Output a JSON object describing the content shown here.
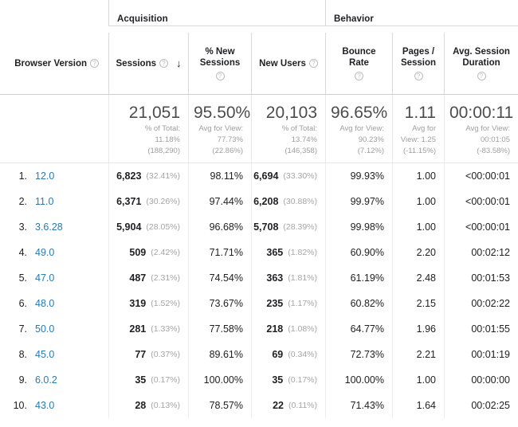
{
  "groups": {
    "acquisition": "Acquisition",
    "behavior": "Behavior"
  },
  "dimension": {
    "label": "Browser Version",
    "help_icon": "help-icon"
  },
  "columns": [
    {
      "key": "sessions",
      "label": "Sessions",
      "help_icon": "help-icon",
      "sorted": true,
      "sort_icon": "arrow-down-icon"
    },
    {
      "key": "pct_new",
      "label": "% New\nSessions",
      "help_icon": "help-icon",
      "sorted": false
    },
    {
      "key": "new_users",
      "label": "New Users",
      "help_icon": "help-icon",
      "sorted": false
    },
    {
      "key": "bounce",
      "label": "Bounce Rate",
      "help_icon": "help-icon",
      "sorted": false
    },
    {
      "key": "pages",
      "label": "Pages /\nSession",
      "help_icon": "help-icon",
      "sorted": false
    },
    {
      "key": "duration",
      "label": "Avg. Session\nDuration",
      "help_icon": "help-icon",
      "sorted": false
    }
  ],
  "summary": {
    "sessions": {
      "big": "21,051",
      "l1": "% of Total:",
      "l2": "11.18%",
      "l3": "(188,290)"
    },
    "pct_new": {
      "big": "95.50%",
      "l1": "Avg for View:",
      "l2": "77.73%",
      "l3": "(22.86%)"
    },
    "new_users": {
      "big": "20,103",
      "l1": "% of Total:",
      "l2": "13.74%",
      "l3": "(146,358)"
    },
    "bounce": {
      "big": "96.65%",
      "l1": "Avg for View:",
      "l2": "90.23%",
      "l3": "(7.12%)"
    },
    "pages": {
      "big": "1.11",
      "l1": "Avg for",
      "l2": "View: 1.25",
      "l3": "(-11.15%)"
    },
    "duration": {
      "big": "00:00:11",
      "l1": "Avg for View:",
      "l2": "00:01:05",
      "l3": "(-83.58%)"
    }
  },
  "rows": [
    {
      "index": "1.",
      "version": "12.0",
      "sessions": "6,823",
      "sessions_pct": "(32.41%)",
      "pct_new": "98.11%",
      "new_users": "6,694",
      "new_users_pct": "(33.30%)",
      "bounce": "99.93%",
      "pages": "1.00",
      "duration": "<00:00:01"
    },
    {
      "index": "2.",
      "version": "11.0",
      "sessions": "6,371",
      "sessions_pct": "(30.26%)",
      "pct_new": "97.44%",
      "new_users": "6,208",
      "new_users_pct": "(30.88%)",
      "bounce": "99.97%",
      "pages": "1.00",
      "duration": "<00:00:01"
    },
    {
      "index": "3.",
      "version": "3.6.28",
      "sessions": "5,904",
      "sessions_pct": "(28.05%)",
      "pct_new": "96.68%",
      "new_users": "5,708",
      "new_users_pct": "(28.39%)",
      "bounce": "99.98%",
      "pages": "1.00",
      "duration": "<00:00:01"
    },
    {
      "index": "4.",
      "version": "49.0",
      "sessions": "509",
      "sessions_pct": "(2.42%)",
      "pct_new": "71.71%",
      "new_users": "365",
      "new_users_pct": "(1.82%)",
      "bounce": "60.90%",
      "pages": "2.20",
      "duration": "00:02:12"
    },
    {
      "index": "5.",
      "version": "47.0",
      "sessions": "487",
      "sessions_pct": "(2.31%)",
      "pct_new": "74.54%",
      "new_users": "363",
      "new_users_pct": "(1.81%)",
      "bounce": "61.19%",
      "pages": "2.48",
      "duration": "00:01:53"
    },
    {
      "index": "6.",
      "version": "48.0",
      "sessions": "319",
      "sessions_pct": "(1.52%)",
      "pct_new": "73.67%",
      "new_users": "235",
      "new_users_pct": "(1.17%)",
      "bounce": "60.82%",
      "pages": "2.15",
      "duration": "00:02:22"
    },
    {
      "index": "7.",
      "version": "50.0",
      "sessions": "281",
      "sessions_pct": "(1.33%)",
      "pct_new": "77.58%",
      "new_users": "218",
      "new_users_pct": "(1.08%)",
      "bounce": "64.77%",
      "pages": "1.96",
      "duration": "00:01:55"
    },
    {
      "index": "8.",
      "version": "45.0",
      "sessions": "77",
      "sessions_pct": "(0.37%)",
      "pct_new": "89.61%",
      "new_users": "69",
      "new_users_pct": "(0.34%)",
      "bounce": "72.73%",
      "pages": "2.21",
      "duration": "00:01:19"
    },
    {
      "index": "9.",
      "version": "6.0.2",
      "sessions": "35",
      "sessions_pct": "(0.17%)",
      "pct_new": "100.00%",
      "new_users": "35",
      "new_users_pct": "(0.17%)",
      "bounce": "100.00%",
      "pages": "1.00",
      "duration": "00:00:00"
    },
    {
      "index": "10.",
      "version": "43.0",
      "sessions": "28",
      "sessions_pct": "(0.13%)",
      "pct_new": "78.57%",
      "new_users": "22",
      "new_users_pct": "(0.11%)",
      "bounce": "71.43%",
      "pages": "1.64",
      "duration": "00:02:25"
    }
  ],
  "colors": {
    "link": "#2a7ab0",
    "text": "#202124",
    "muted": "#9e9e9e",
    "border": "#d9d9d9"
  }
}
